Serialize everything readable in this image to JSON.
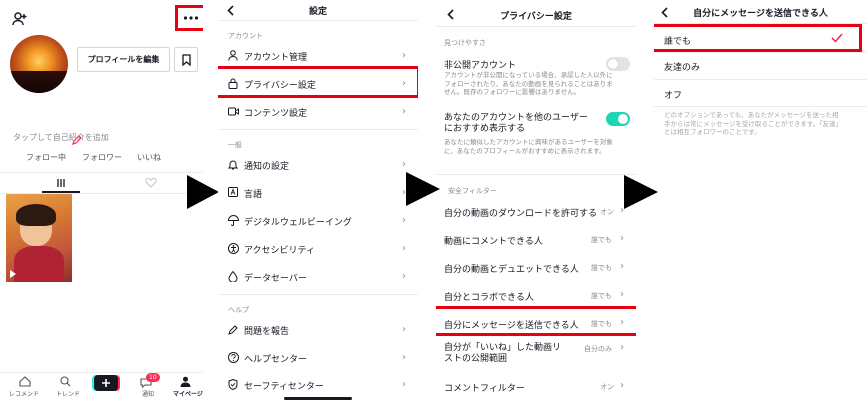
{
  "profile": {
    "edit_profile_label": "プロフィールを編集",
    "bio_placeholder": "タップして自己紹介を追加",
    "stats": [
      "フォロー中",
      "フォロワー",
      "いいね"
    ],
    "nav": [
      "レコメンド",
      "トレンド",
      "",
      "通知",
      "マイページ"
    ],
    "notif_badge": "10"
  },
  "settings": {
    "title": "設定",
    "section_account": "アカウント",
    "account_items": [
      "アカウント管理",
      "プライバシー設定",
      "コンテンツ設定"
    ],
    "section_general": "一般",
    "general_items": [
      "通知の設定",
      "言語",
      "デジタルウェルビーイング",
      "アクセシビリティ",
      "データセーバー"
    ],
    "section_help": "ヘルプ",
    "help_items": [
      "問題を報告",
      "ヘルプセンター",
      "セーフティセンター"
    ]
  },
  "privacy": {
    "title": "プライバシー設定",
    "section_discover": "見つけやすさ",
    "private_label": "非公開アカウント",
    "private_desc": "アカウントが非公開になっている場合、承認した人以外にフォローされたり、あなたの動画を見られることはありません。既存のフォロワーに影響はありません。",
    "suggest_label": "あなたのアカウントを他のユーザーにおすすめ表示する",
    "suggest_desc": "あなたに類似したアカウントに興味があるユーザーを対象に、あなたのプロフィールがおすすめに表示されます。",
    "section_safety": "安全フィルター",
    "rows": [
      {
        "label": "自分の動画のダウンロードを許可する",
        "value": "オン"
      },
      {
        "label": "動画にコメントできる人",
        "value": "誰でも"
      },
      {
        "label": "自分の動画とデュエットできる人",
        "value": "誰でも"
      },
      {
        "label": "自分とコラボできる人",
        "value": "誰でも"
      },
      {
        "label": "自分にメッセージを送信できる人",
        "value": "誰でも"
      },
      {
        "label": "自分が「いいね」した動画リストの公開範囲",
        "value": "自分のみ"
      },
      {
        "label": "コメントフィルター",
        "value": "オン"
      }
    ]
  },
  "message": {
    "title": "自分にメッセージを送信できる人",
    "options": [
      "誰でも",
      "友達のみ",
      "オフ"
    ],
    "note": "どのオプションであっても、あなたがメッセージを送った相手からは常にメッセージを受け取ることができます。「友達」とは相互フォロワーのことです。"
  },
  "colors": {
    "highlight": "#e60012",
    "toggle_on": "#20d5b5",
    "accent": "#fe2c55"
  }
}
